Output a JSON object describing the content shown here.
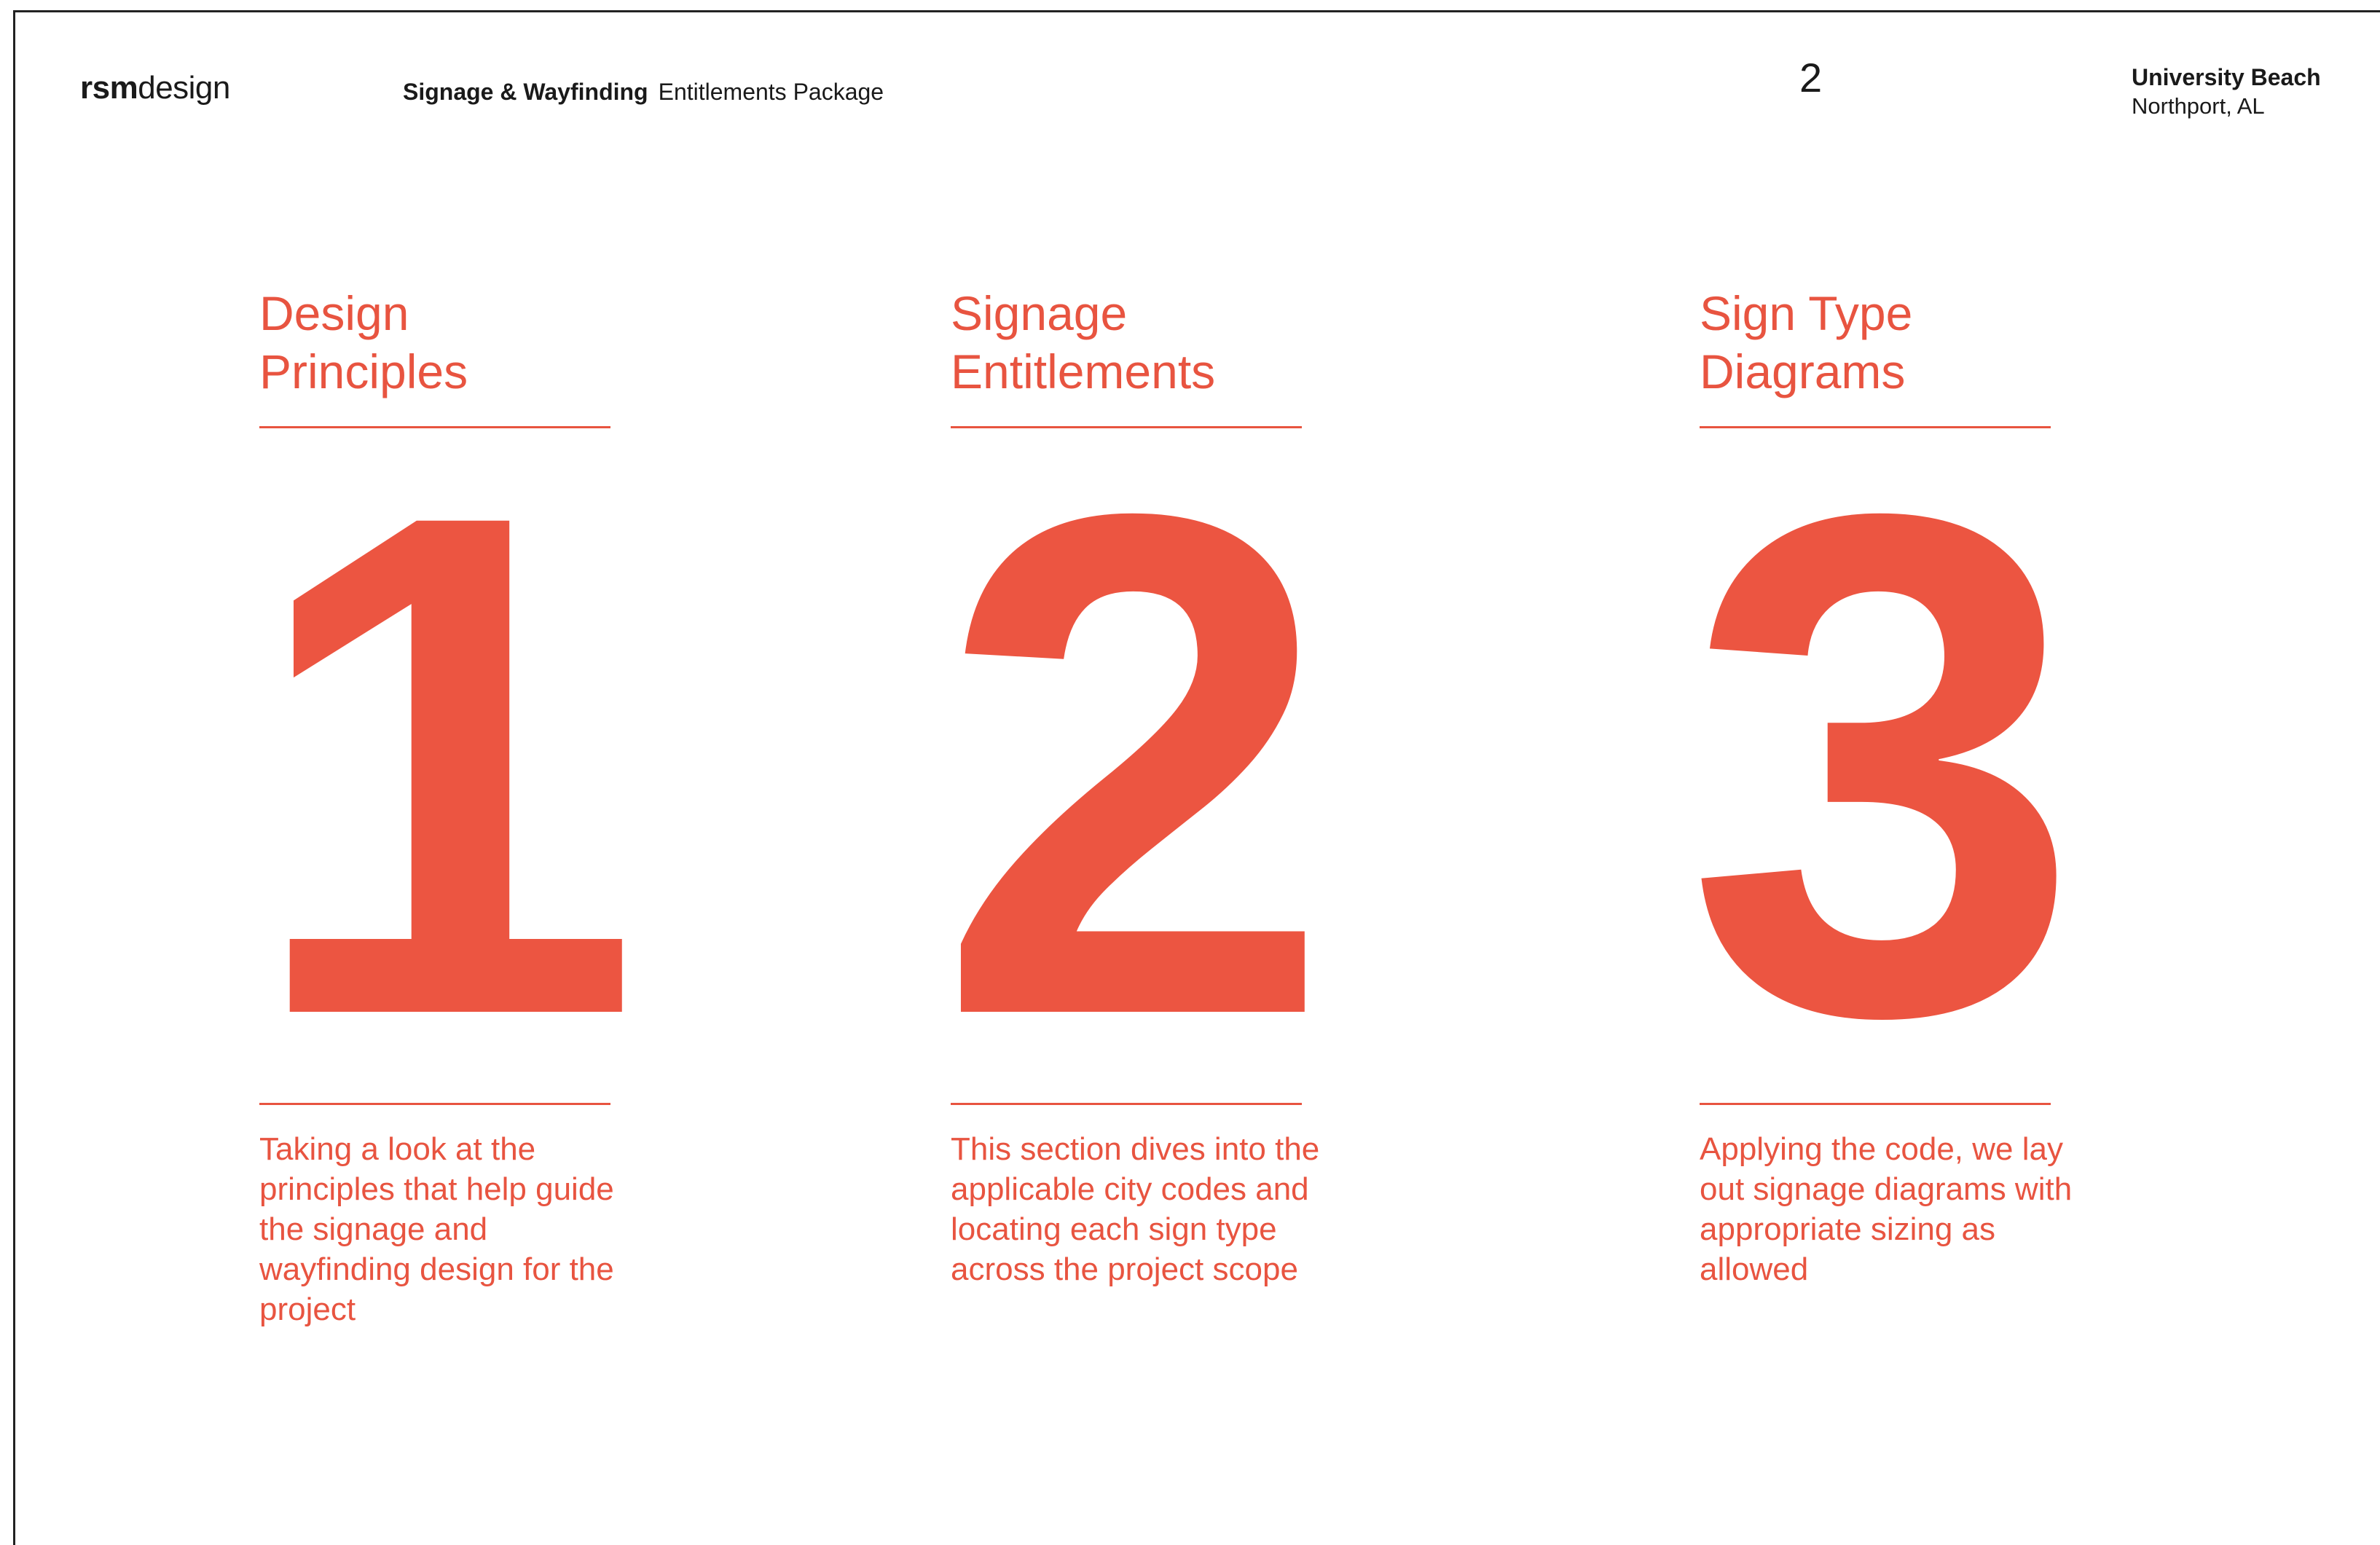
{
  "header": {
    "brand_bold": "rsm",
    "brand_light": "design",
    "title_bold": "Signage & Wayfinding",
    "title_light": "Entitlements Package",
    "page_number": "2",
    "project_name": "University Beach",
    "project_location": "Northport, AL"
  },
  "sections": [
    {
      "heading_line1": "Design",
      "heading_line2": "Principles",
      "numeral": "1",
      "description": "Taking a look at the principles that help guide the signage and wayfinding design for the project"
    },
    {
      "heading_line1": "Signage",
      "heading_line2": "Entitlements",
      "numeral": "2",
      "description": "This section dives into the applicable city codes and locating each sign type across the project scope"
    },
    {
      "heading_line1": "Sign Type",
      "heading_line2": "Diagrams",
      "numeral": "3",
      "description": "Applying the code, we lay out signage diagrams with appropriate sizing as allowed"
    }
  ],
  "colors": {
    "accent": "#ec5541",
    "text_dark": "#1a1a1a",
    "background": "#ffffff"
  }
}
